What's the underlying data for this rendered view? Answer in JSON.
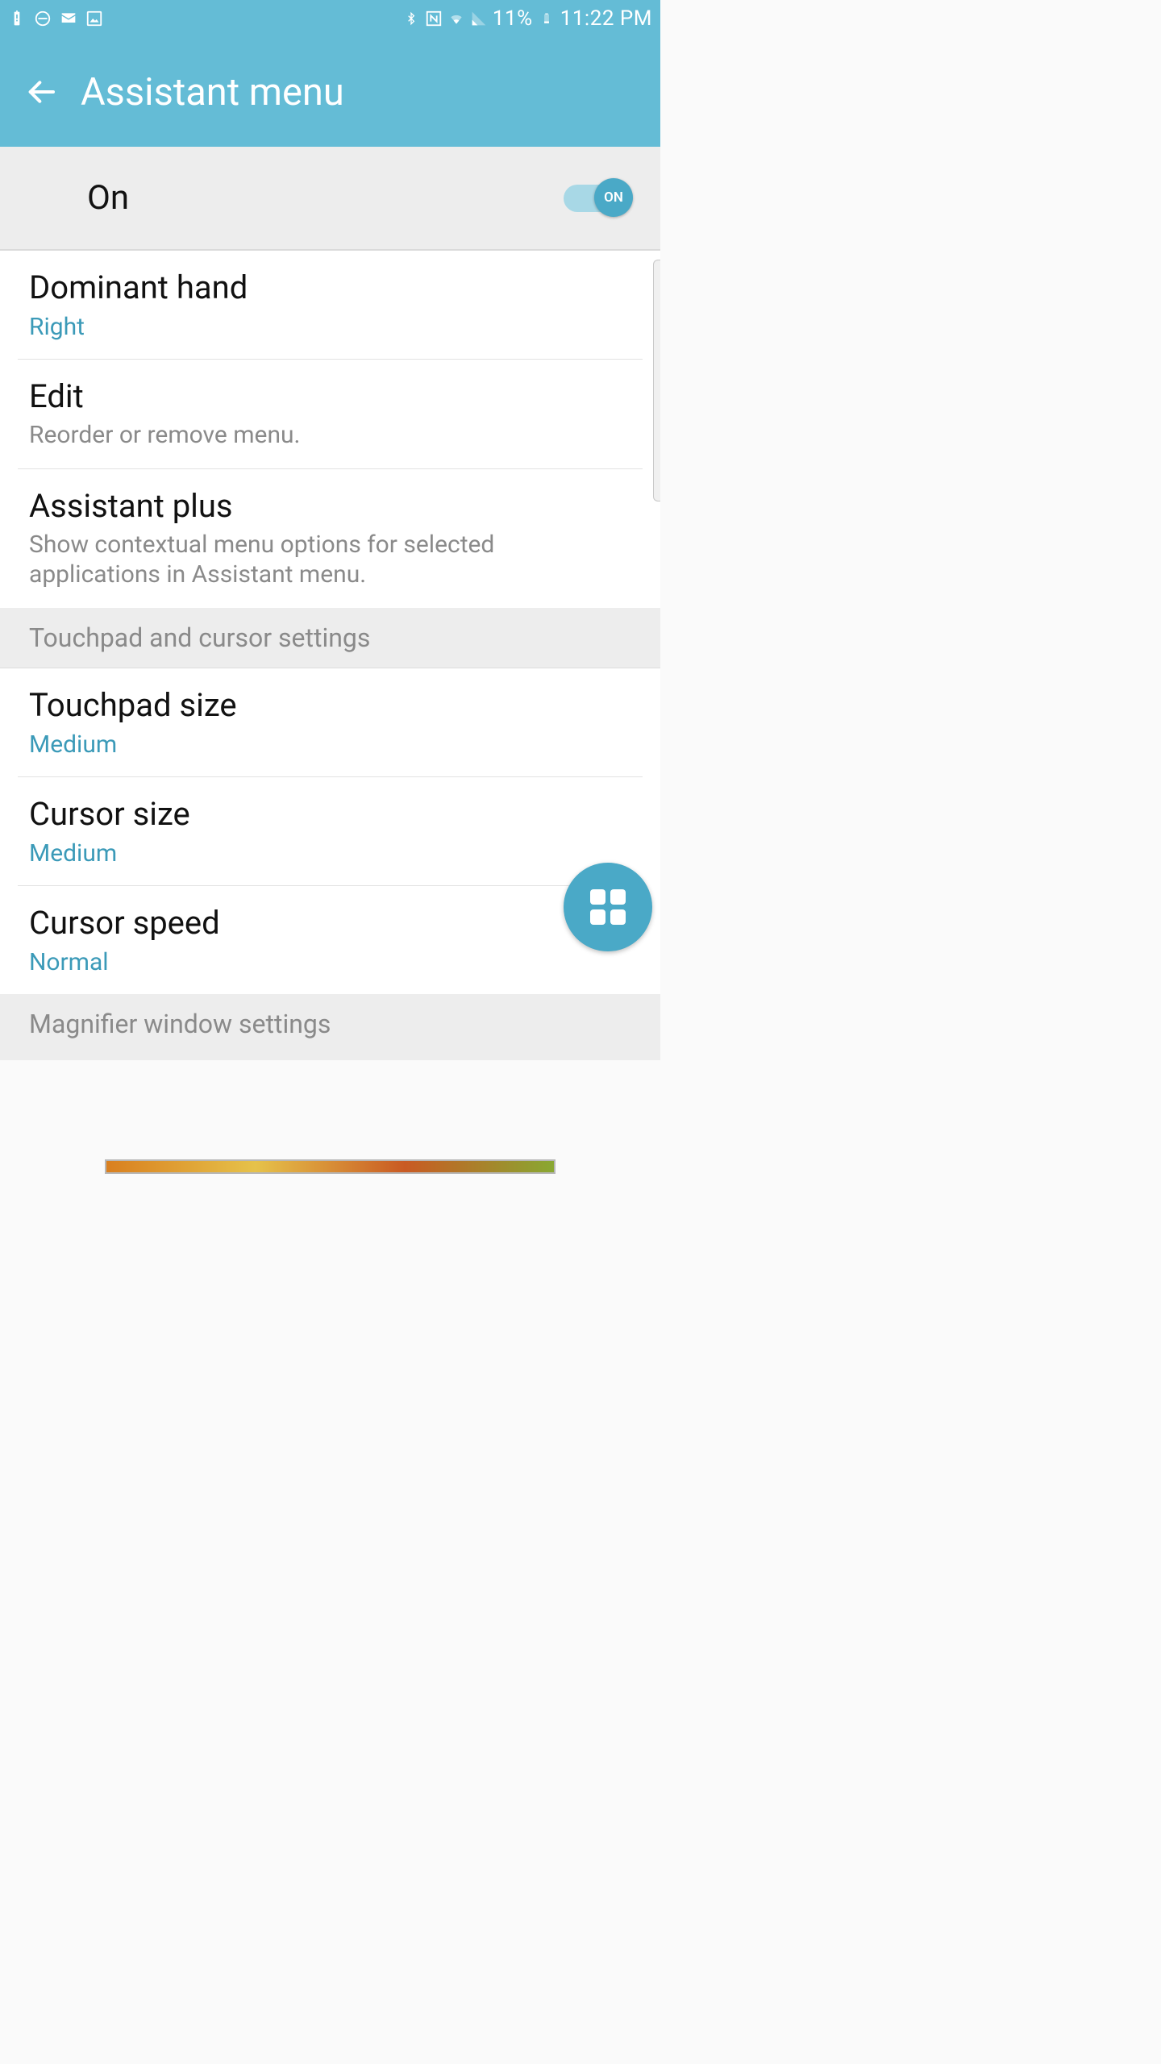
{
  "status": {
    "battery_pct": "11%",
    "time": "11:22 PM"
  },
  "header": {
    "title": "Assistant menu"
  },
  "master": {
    "label": "On",
    "toggle_text": "ON"
  },
  "settings": {
    "dominant_hand": {
      "title": "Dominant hand",
      "value": "Right"
    },
    "edit": {
      "title": "Edit",
      "sub": "Reorder or remove menu."
    },
    "assistant_plus": {
      "title": "Assistant plus",
      "sub": "Show contextual menu options for selected applications in Assistant menu."
    },
    "touchpad_size": {
      "title": "Touchpad size",
      "value": "Medium"
    },
    "cursor_size": {
      "title": "Cursor size",
      "value": "Medium"
    },
    "cursor_speed": {
      "title": "Cursor speed",
      "value": "Normal"
    }
  },
  "sections": {
    "touchpad": "Touchpad and cursor settings",
    "magnifier": "Magnifier window settings"
  }
}
